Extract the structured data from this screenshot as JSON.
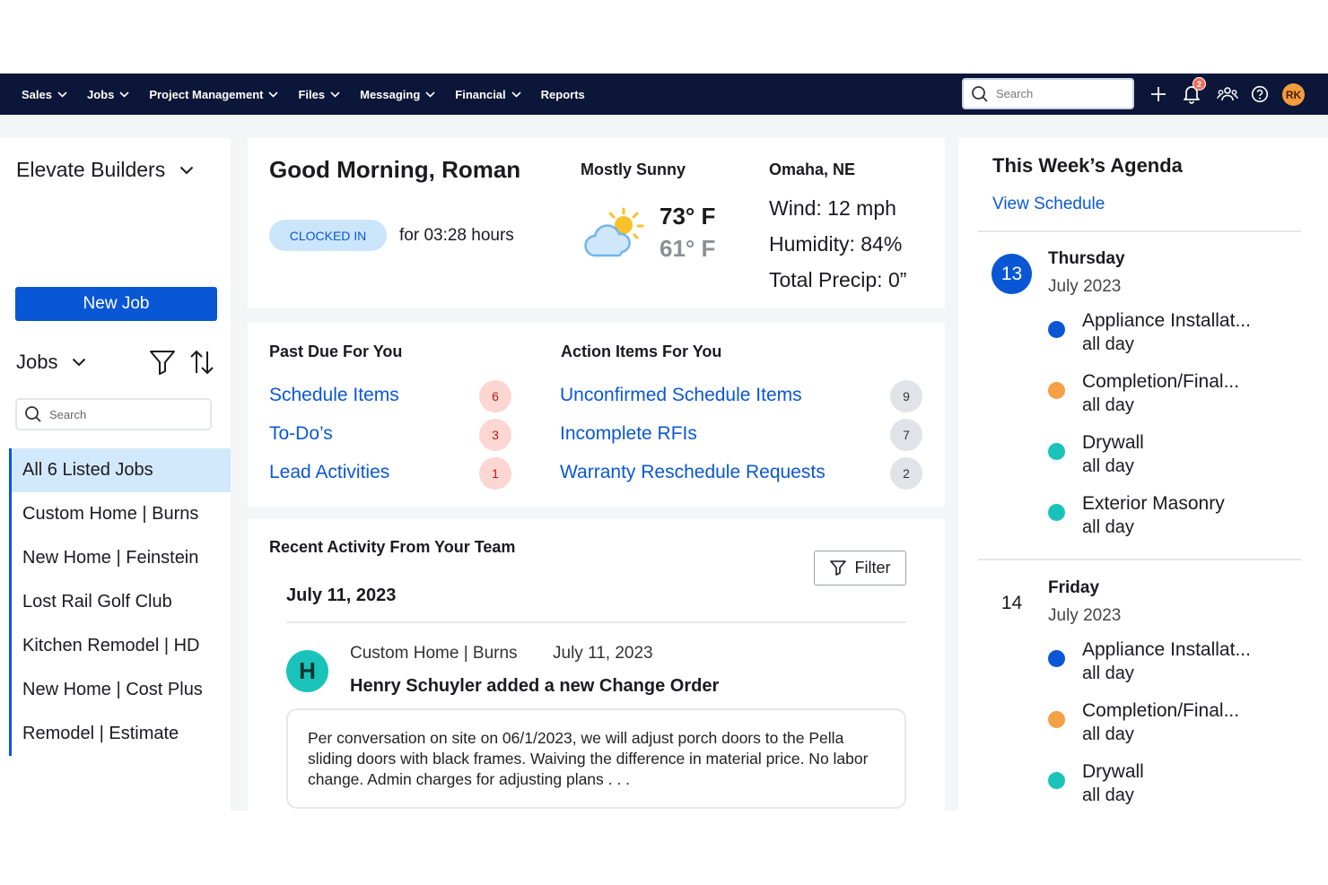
{
  "topnav": {
    "items": [
      {
        "label": "Sales",
        "has_menu": true
      },
      {
        "label": "Jobs",
        "has_menu": true
      },
      {
        "label": "Project Management",
        "has_menu": true
      },
      {
        "label": "Files",
        "has_menu": true
      },
      {
        "label": "Messaging",
        "has_menu": true
      },
      {
        "label": "Financial",
        "has_menu": true
      },
      {
        "label": "Reports",
        "has_menu": false
      }
    ],
    "search_placeholder": "Search",
    "notification_count": "2",
    "user_initials": "RK",
    "icons": [
      "search-icon",
      "plus-icon",
      "bell-icon",
      "team-icon",
      "help-icon"
    ]
  },
  "sidebar": {
    "company": "Elevate Builders",
    "new_job_label": "New Job",
    "jobs_label": "Jobs",
    "search_placeholder": "Search",
    "jobs": [
      {
        "label": "All 6 Listed Jobs",
        "active": true
      },
      {
        "label": "Custom Home | Burns"
      },
      {
        "label": "New Home | Feinstein"
      },
      {
        "label": "Lost Rail Golf Club"
      },
      {
        "label": "Kitchen Remodel | HD"
      },
      {
        "label": "New Home | Cost Plus"
      },
      {
        "label": "Remodel | Estimate"
      }
    ]
  },
  "greeting": {
    "title": "Good Morning, Roman",
    "status": "CLOCKED IN",
    "duration": "for 03:28 hours"
  },
  "weather": {
    "condition": "Mostly Sunny",
    "high": "73° F",
    "low": "61° F",
    "location": "Omaha, NE",
    "wind": "Wind: 12 mph",
    "humidity": "Humidity: 84%",
    "precip": "Total Precip: 0”"
  },
  "past_due": {
    "title": "Past Due For You",
    "items": [
      {
        "label": "Schedule Items",
        "count": "6"
      },
      {
        "label": "To-Do’s",
        "count": "3"
      },
      {
        "label": "Lead Activities",
        "count": "1"
      }
    ]
  },
  "action_items": {
    "title": "Action Items For You",
    "items": [
      {
        "label": "Unconfirmed Schedule Items",
        "count": "9"
      },
      {
        "label": "Incomplete RFIs",
        "count": "7"
      },
      {
        "label": "Warranty Reschedule Requests",
        "count": "2"
      }
    ]
  },
  "activity": {
    "title": "Recent Activity From Your Team",
    "filter_label": "Filter",
    "date": "July 11, 2023",
    "entry": {
      "avatar_initial": "H",
      "job": "Custom Home | Burns",
      "date": "July 11, 2023",
      "headline": "Henry Schuyler added a new Change Order",
      "note": "Per conversation on site on 06/1/2023, we will adjust porch doors to the Pella sliding doors with black frames. Waiving the difference in material price. No labor change. Admin charges for adjusting plans . . ."
    }
  },
  "agenda": {
    "title": "This Week’s Agenda",
    "view_link": "View Schedule",
    "colors": {
      "blue": "#0a57d6",
      "orange": "#f5a044",
      "teal": "#19c3b9"
    },
    "days": [
      {
        "day_number": "13",
        "day_name": "Thursday",
        "month": "July 2023",
        "events": [
          {
            "name": "Appliance Installat...",
            "time": "all day",
            "color": "#0a57d6"
          },
          {
            "name": "Completion/Final...",
            "time": "all day",
            "color": "#f5a044"
          },
          {
            "name": "Drywall",
            "time": "all day",
            "color": "#19c3b9"
          },
          {
            "name": "Exterior Masonry",
            "time": "all day",
            "color": "#19c3b9"
          }
        ]
      },
      {
        "day_number": "14",
        "day_name": "Friday",
        "month": "July 2023",
        "events": [
          {
            "name": "Appliance Installat...",
            "time": "all day",
            "color": "#0a57d6"
          },
          {
            "name": "Completion/Final...",
            "time": "all day",
            "color": "#f5a044"
          },
          {
            "name": "Drywall",
            "time": "all day",
            "color": "#19c3b9"
          }
        ]
      }
    ]
  }
}
